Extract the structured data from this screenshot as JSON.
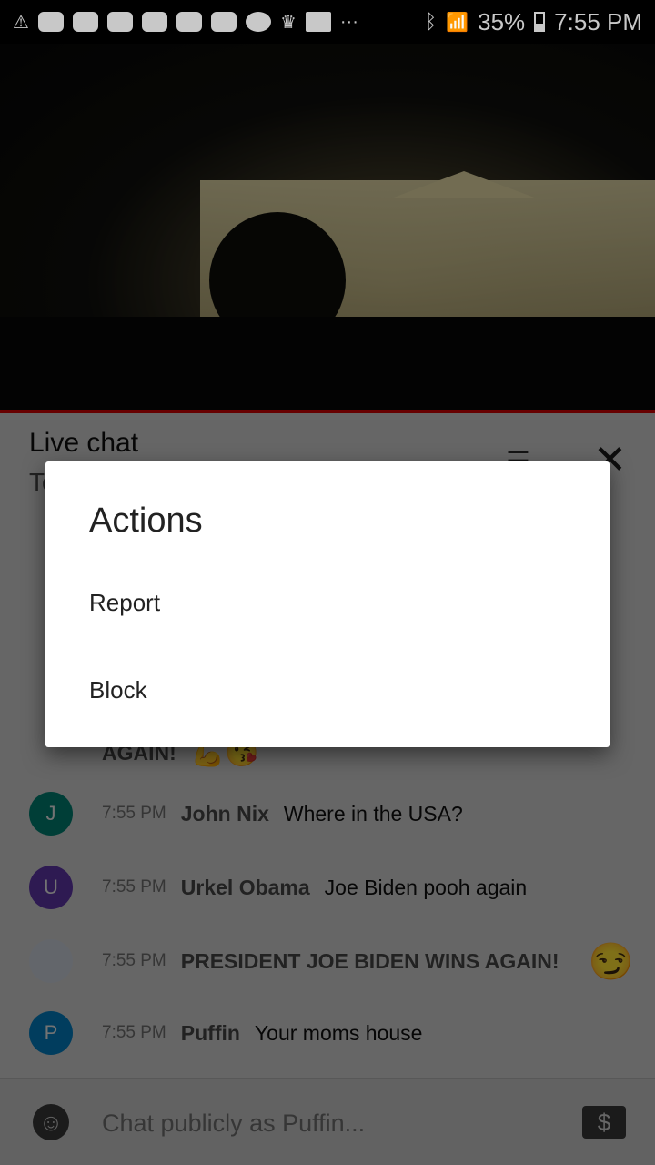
{
  "status_bar": {
    "battery": "35%",
    "time": "7:55 PM"
  },
  "live_chat": {
    "title": "Live chat",
    "subtitle": "To"
  },
  "messages": [
    {
      "avatar_letter": "J",
      "avatar_color": "#00897b",
      "time": "7:55 PM",
      "author": "John Nix",
      "text": "Where in the USA?"
    },
    {
      "avatar_letter": "U",
      "avatar_color": "#673ab7",
      "time": "7:55 PM",
      "author": "Urkel Obama",
      "text": "Joe Biden pooh again"
    },
    {
      "avatar_letter": "",
      "avatar_color": "#dde3ee",
      "time": "7:55 PM",
      "author": "PRESIDENT JOE BIDEN WINS AGAIN!",
      "text": "",
      "emoji": "😏"
    },
    {
      "avatar_letter": "P",
      "avatar_color": "#0288d1",
      "time": "7:55 PM",
      "author": "Puffin",
      "text": "Your moms house"
    }
  ],
  "partial_message": {
    "text": "AGAIN!",
    "emoji": "💪😘"
  },
  "input": {
    "placeholder": "Chat publicly as Puffin..."
  },
  "dialog": {
    "title": "Actions",
    "items": [
      "Report",
      "Block"
    ]
  },
  "accent": "#cc0000"
}
